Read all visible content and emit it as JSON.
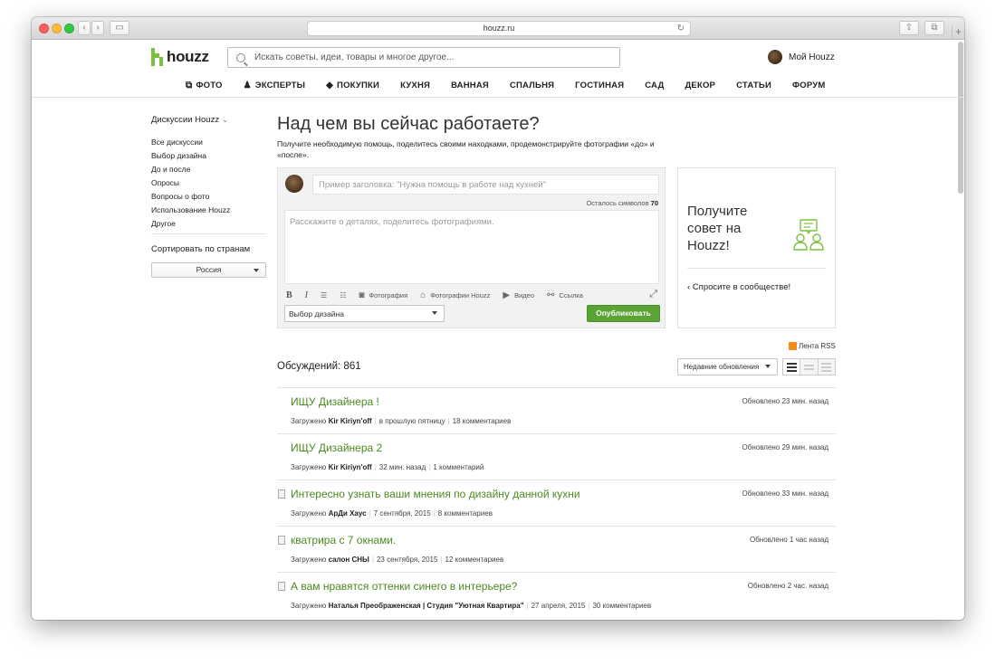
{
  "browser": {
    "url": "houzz.ru",
    "reload_glyph": "↻",
    "back_glyph": "‹",
    "forward_glyph": "›",
    "sidebar_glyph": "▭",
    "share_glyph": "⇧",
    "tabs_glyph": "⧉",
    "new_tab_glyph": "+"
  },
  "header": {
    "logo_text": "houzz",
    "search_placeholder": "Искать советы, идеи, товары и многое другое...",
    "my_houzz": "Мой Houzz"
  },
  "nav": [
    {
      "label": "ФОТО",
      "icon": "photo-icon",
      "glyph": "⧉"
    },
    {
      "label": "ЭКСПЕРТЫ",
      "icon": "expert-icon",
      "glyph": "♟"
    },
    {
      "label": "ПОКУПКИ",
      "icon": "tag-icon",
      "glyph": "◆"
    },
    {
      "label": "КУХНЯ"
    },
    {
      "label": "ВАННАЯ"
    },
    {
      "label": "СПАЛЬНЯ"
    },
    {
      "label": "ГОСТИНАЯ"
    },
    {
      "label": "САД"
    },
    {
      "label": "ДЕКОР"
    },
    {
      "label": "СТАТЬИ"
    },
    {
      "label": "ФОРУМ"
    }
  ],
  "sidebar": {
    "title": "Дискуссии Houzz",
    "title_caret": "⌄",
    "items": [
      "Все дискуссии",
      "Выбор дизайна",
      "До и после",
      "Опросы",
      "Вопросы о фото",
      "Использование Houzz",
      "Другое"
    ],
    "sort_label": "Сортировать по странам",
    "country": "Россия"
  },
  "compose": {
    "title": "Над чем вы сейчас работаете?",
    "subtitle": "Получите необходимую помощь, поделитесь своими находками, продемонстрируйте фотографии «до» и «после».",
    "title_placeholder": "Пример заголовка: \"Нужна помощь в работе над кухней\"",
    "chars_left_label": "Осталось символов",
    "chars_left_value": "70",
    "details_placeholder": "Расскажите о деталях, поделитесь фотографиями.",
    "toolbar": {
      "bold": "B",
      "italic": "I",
      "bullets_glyph": "☰",
      "numbered_glyph": "☷",
      "photo_glyph": "◙",
      "photo": "Фотография",
      "houzz_photos_glyph": "⌂",
      "houzz_photos": "Фотографии Houzz",
      "video_glyph": "▶",
      "video": "Видео",
      "link_glyph": "⚯",
      "link": "Ссылка",
      "expand_glyph": "⤢"
    },
    "category": "Выбор дизайна",
    "publish": "Опубликовать"
  },
  "promo": {
    "text": "Получите совет на Houzz!",
    "link_arrow": "‹",
    "link": "Спросите в сообществе!",
    "accent": "#7ac142"
  },
  "list": {
    "rss": "Лента RSS",
    "count_label": "Обсуждений: 861",
    "sort": "Недавние обновления",
    "items": [
      {
        "title": "ИЩУ Дизайнера !",
        "updated": "Обновлено 23 мин. назад",
        "prefix": "Загружено",
        "author": "Kir Kiriyn'off",
        "date": "в прошлую пятницу",
        "comments": "18 комментариев",
        "doc": false
      },
      {
        "title": "ИЩУ Дизайнера 2",
        "updated": "Обновлено 29 мин. назад",
        "prefix": "Загружено",
        "author": "Kir Kiriyn'off",
        "date": "32 мин. назад",
        "comments": "1 комментарий",
        "doc": false
      },
      {
        "title": "Интересно узнать ваши мнения по дизайну данной кухни",
        "updated": "Обновлено 33 мин. назад",
        "prefix": "Загружено",
        "author": "АрДи Хаус",
        "date": "7 сентября, 2015",
        "comments": "8 комментариев",
        "doc": true
      },
      {
        "title": "кватрира с 7 окнами.",
        "updated": "Обновлено 1 час назад",
        "prefix": "Загружено",
        "author": "салон СНЫ",
        "date": "23 сентября, 2015",
        "comments": "12 комментариев",
        "doc": true
      },
      {
        "title": "А вам нравятся оттенки синего в интерьере?",
        "updated": "Обновлено 2 час. назад",
        "prefix": "Загружено",
        "author": "Наталья Преображенская | Студия \"Уютная Квартира\"",
        "date": "27 апреля, 2015",
        "comments": "30 комментариев",
        "doc": true
      }
    ],
    "title_color": "#4b8a1f"
  }
}
